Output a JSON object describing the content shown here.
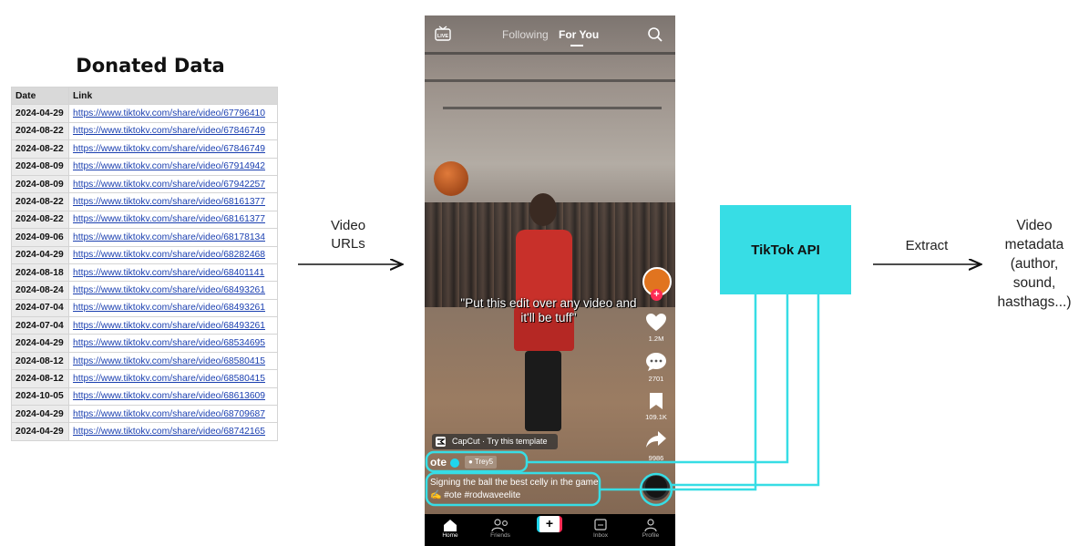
{
  "donated": {
    "title": "Donated Data",
    "columns": [
      "Date",
      "Link"
    ],
    "rows": [
      [
        "2024-04-29",
        "https://www.tiktokv.com/share/video/67796410"
      ],
      [
        "2024-08-22",
        "https://www.tiktokv.com/share/video/67846749"
      ],
      [
        "2024-08-22",
        "https://www.tiktokv.com/share/video/67846749"
      ],
      [
        "2024-08-09",
        "https://www.tiktokv.com/share/video/67914942"
      ],
      [
        "2024-08-09",
        "https://www.tiktokv.com/share/video/67942257"
      ],
      [
        "2024-08-22",
        "https://www.tiktokv.com/share/video/68161377"
      ],
      [
        "2024-08-22",
        "https://www.tiktokv.com/share/video/68161377"
      ],
      [
        "2024-09-06",
        "https://www.tiktokv.com/share/video/68178134"
      ],
      [
        "2024-04-29",
        "https://www.tiktokv.com/share/video/68282468"
      ],
      [
        "2024-08-18",
        "https://www.tiktokv.com/share/video/68401141"
      ],
      [
        "2024-08-24",
        "https://www.tiktokv.com/share/video/68493261"
      ],
      [
        "2024-07-04",
        "https://www.tiktokv.com/share/video/68493261"
      ],
      [
        "2024-07-04",
        "https://www.tiktokv.com/share/video/68493261"
      ],
      [
        "2024-04-29",
        "https://www.tiktokv.com/share/video/68534695"
      ],
      [
        "2024-08-12",
        "https://www.tiktokv.com/share/video/68580415"
      ],
      [
        "2024-08-12",
        "https://www.tiktokv.com/share/video/68580415"
      ],
      [
        "2024-10-05",
        "https://www.tiktokv.com/share/video/68613609"
      ],
      [
        "2024-04-29",
        "https://www.tiktokv.com/share/video/68709687"
      ],
      [
        "2024-04-29",
        "https://www.tiktokv.com/share/video/68742165"
      ]
    ]
  },
  "flow": {
    "video_urls": [
      "Video",
      "URLs"
    ],
    "api": "TikTok API",
    "extract": "Extract",
    "metadata": [
      "Video",
      "metadata",
      "(author,",
      "sound,",
      "hasthags...)"
    ]
  },
  "phone": {
    "tabs": [
      "Following",
      "For You"
    ],
    "live_label": "LIVE",
    "caption": "\"Put this edit over any video and it'll be tuff\"",
    "counts": {
      "likes": "1.2M",
      "comments": "2701",
      "saves": "109.1K",
      "shares": "9986"
    },
    "capcut": "CapCut · Try this template",
    "username": "ote",
    "sound_chip": "Trey5",
    "description": "Signing the ball the best celly in the game ✍️ #ote #rodwaveelite",
    "nav": [
      "Home",
      "Friends",
      "Inbox",
      "Profile"
    ],
    "create_symbol": "+"
  },
  "colors": {
    "highlight": "#37dde5",
    "api_box": "#37dde5",
    "like_badge": "#fe2c55"
  }
}
